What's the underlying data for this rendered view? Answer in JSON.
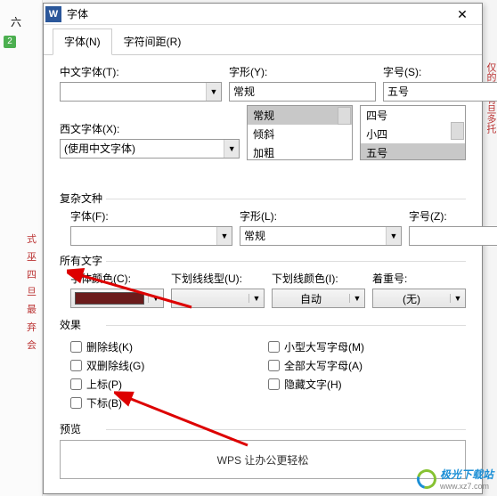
{
  "bg": {
    "line_marker": "2",
    "left_text": "式巫 四旦最弃 会",
    "top_six": "六",
    "right_text": "仅的新 有旦多托"
  },
  "window": {
    "title": "字体"
  },
  "tabs": {
    "t0": "字体(N)",
    "t1": "字符间距(R)"
  },
  "cn_font": {
    "label": "中文字体(T):",
    "value": ""
  },
  "style": {
    "label": "字形(Y):",
    "value": "常规",
    "opts": {
      "o0": "常规",
      "o1": "倾斜",
      "o2": "加粗"
    }
  },
  "size": {
    "label": "字号(S):",
    "value": "五号",
    "opts": {
      "o0": "四号",
      "o1": "小四",
      "o2": "五号"
    }
  },
  "west_font": {
    "label": "西文字体(X):",
    "value": "(使用中文字体)"
  },
  "complex": {
    "header": "复杂文种",
    "fontL": "字体(F):",
    "fontV": "",
    "styleL": "字形(L):",
    "styleV": "常规",
    "sizeL": "字号(Z):",
    "sizeV": ""
  },
  "alltext": {
    "header": "所有文字",
    "colorL": "字体颜色(C):",
    "ulineL": "下划线线型(U):",
    "ulineV": "",
    "ucolorL": "下划线颜色(I):",
    "ucolorV": "自动",
    "emphL": "着重号:",
    "emphV": "(无)"
  },
  "effects": {
    "header": "效果",
    "strike": "删除线(K)",
    "dstrike": "双删除线(G)",
    "sup": "上标(P)",
    "sub": "下标(B)",
    "smallcaps": "小型大写字母(M)",
    "allcaps": "全部大写字母(A)",
    "hidden": "隐藏文字(H)"
  },
  "preview": {
    "header": "预览",
    "sample": "WPS 让办公更轻松"
  },
  "logo": {
    "text": "极光下载站",
    "url": "www.xz7.com"
  }
}
